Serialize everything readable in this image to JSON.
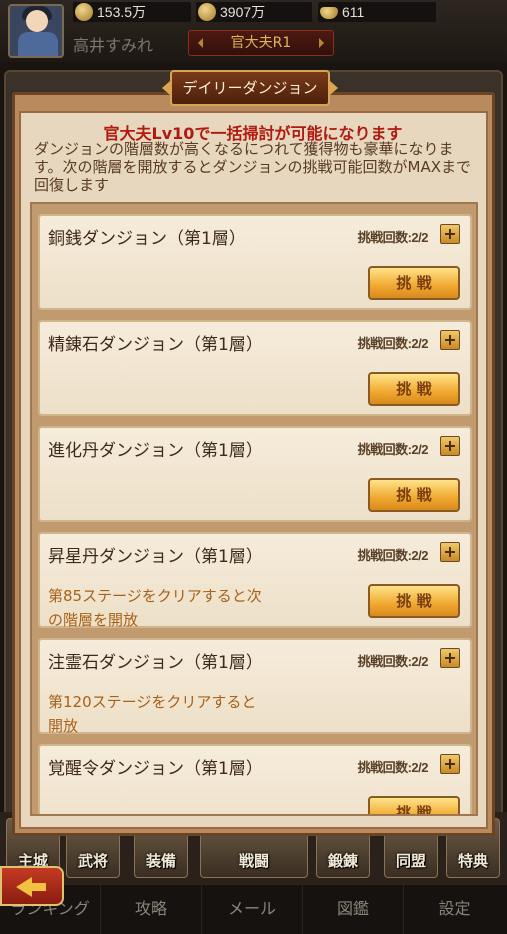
{
  "resources": [
    {
      "icon": "coin-icon",
      "value": "153.5万"
    },
    {
      "icon": "copper-coin-icon",
      "value": "3907万"
    },
    {
      "icon": "gold-ingot-icon",
      "value": "611"
    }
  ],
  "player": {
    "name": "高井すみれ",
    "rank": "官大夫R1"
  },
  "modal": {
    "title": "デイリーダンジョン",
    "notice_red": "官大夫Lv10で一括掃討が可能になります",
    "notice_body": "ダンジョンの階層数が高くなるにつれて獲得物も豪華になります。次の階層を開放するとダンジョンの挑戦可能回数がMAXまで回復します"
  },
  "dungeons": [
    {
      "name": "銅銭ダンジョン（第1層）",
      "count": "挑戦回数:2/2",
      "note": "",
      "button": "挑 戦"
    },
    {
      "name": "精錬石ダンジョン（第1層）",
      "count": "挑戦回数:2/2",
      "note": "",
      "button": "挑 戦"
    },
    {
      "name": "進化丹ダンジョン（第1層）",
      "count": "挑戦回数:2/2",
      "note": "",
      "button": "挑 戦"
    },
    {
      "name": "昇星丹ダンジョン（第1層）",
      "count": "挑戦回数:2/2",
      "note": "第85ステージをクリアすると次の階層を開放",
      "button": "挑 戦"
    },
    {
      "name": "注霊石ダンジョン（第1層）",
      "count": "挑戦回数:2/2",
      "note": "第120ステージをクリアすると開放",
      "button": ""
    },
    {
      "name": "覚醒令ダンジョン（第1層）",
      "count": "挑戦回数:2/2",
      "note": "",
      "button": "挑 戦"
    }
  ],
  "bottom_nav": [
    "主城",
    "武将",
    "装備",
    "戦闘",
    "鍛錬",
    "同盟",
    "特典"
  ],
  "footer": [
    "ランキング",
    "攻略",
    "メール",
    "図鑑",
    "設定"
  ]
}
